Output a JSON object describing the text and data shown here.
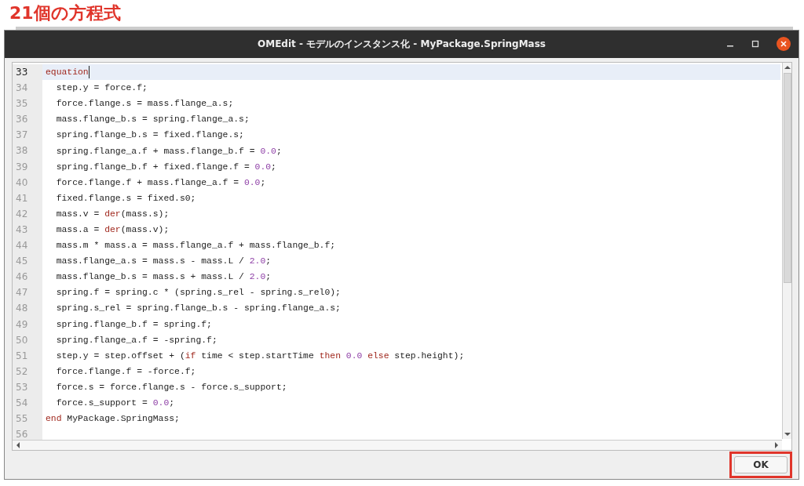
{
  "caption": "21個の方程式",
  "window": {
    "title": "OMEdit - モデルのインスタンス化 - MyPackage.SpringMass"
  },
  "editor": {
    "lines": [
      {
        "number": "33",
        "current": true,
        "tokens": [
          {
            "t": "equation",
            "kind": "keyword"
          }
        ]
      },
      {
        "number": "34",
        "current": false,
        "tokens": [
          {
            "t": "  step.y = force.f;",
            "kind": "plain"
          }
        ]
      },
      {
        "number": "35",
        "current": false,
        "tokens": [
          {
            "t": "  force.flange.s = mass.flange_a.s;",
            "kind": "plain"
          }
        ]
      },
      {
        "number": "36",
        "current": false,
        "tokens": [
          {
            "t": "  mass.flange_b.s = spring.flange_a.s;",
            "kind": "plain"
          }
        ]
      },
      {
        "number": "37",
        "current": false,
        "tokens": [
          {
            "t": "  spring.flange_b.s = fixed.flange.s;",
            "kind": "plain"
          }
        ]
      },
      {
        "number": "38",
        "current": false,
        "tokens": [
          {
            "t": "  spring.flange_a.f + mass.flange_b.f = ",
            "kind": "plain"
          },
          {
            "t": "0.0",
            "kind": "number"
          },
          {
            "t": ";",
            "kind": "plain"
          }
        ]
      },
      {
        "number": "39",
        "current": false,
        "tokens": [
          {
            "t": "  spring.flange_b.f + fixed.flange.f = ",
            "kind": "plain"
          },
          {
            "t": "0.0",
            "kind": "number"
          },
          {
            "t": ";",
            "kind": "plain"
          }
        ]
      },
      {
        "number": "40",
        "current": false,
        "tokens": [
          {
            "t": "  force.flange.f + mass.flange_a.f = ",
            "kind": "plain"
          },
          {
            "t": "0.0",
            "kind": "number"
          },
          {
            "t": ";",
            "kind": "plain"
          }
        ]
      },
      {
        "number": "41",
        "current": false,
        "tokens": [
          {
            "t": "  fixed.flange.s = fixed.s0;",
            "kind": "plain"
          }
        ]
      },
      {
        "number": "42",
        "current": false,
        "tokens": [
          {
            "t": "  mass.v = ",
            "kind": "plain"
          },
          {
            "t": "der",
            "kind": "keyword"
          },
          {
            "t": "(mass.s);",
            "kind": "plain"
          }
        ]
      },
      {
        "number": "43",
        "current": false,
        "tokens": [
          {
            "t": "  mass.a = ",
            "kind": "plain"
          },
          {
            "t": "der",
            "kind": "keyword"
          },
          {
            "t": "(mass.v);",
            "kind": "plain"
          }
        ]
      },
      {
        "number": "44",
        "current": false,
        "tokens": [
          {
            "t": "  mass.m * mass.a = mass.flange_a.f + mass.flange_b.f;",
            "kind": "plain"
          }
        ]
      },
      {
        "number": "45",
        "current": false,
        "tokens": [
          {
            "t": "  mass.flange_a.s = mass.s - mass.L / ",
            "kind": "plain"
          },
          {
            "t": "2.0",
            "kind": "number"
          },
          {
            "t": ";",
            "kind": "plain"
          }
        ]
      },
      {
        "number": "46",
        "current": false,
        "tokens": [
          {
            "t": "  mass.flange_b.s = mass.s + mass.L / ",
            "kind": "plain"
          },
          {
            "t": "2.0",
            "kind": "number"
          },
          {
            "t": ";",
            "kind": "plain"
          }
        ]
      },
      {
        "number": "47",
        "current": false,
        "tokens": [
          {
            "t": "  spring.f = spring.c * (spring.s_rel - spring.s_rel0);",
            "kind": "plain"
          }
        ]
      },
      {
        "number": "48",
        "current": false,
        "tokens": [
          {
            "t": "  spring.s_rel = spring.flange_b.s - spring.flange_a.s;",
            "kind": "plain"
          }
        ]
      },
      {
        "number": "49",
        "current": false,
        "tokens": [
          {
            "t": "  spring.flange_b.f = spring.f;",
            "kind": "plain"
          }
        ]
      },
      {
        "number": "50",
        "current": false,
        "tokens": [
          {
            "t": "  spring.flange_a.f = -spring.f;",
            "kind": "plain"
          }
        ]
      },
      {
        "number": "51",
        "current": false,
        "tokens": [
          {
            "t": "  step.y = step.offset + (",
            "kind": "plain"
          },
          {
            "t": "if",
            "kind": "keyword"
          },
          {
            "t": " time < step.startTime ",
            "kind": "plain"
          },
          {
            "t": "then ",
            "kind": "keyword"
          },
          {
            "t": "0.0",
            "kind": "number"
          },
          {
            "t": " else",
            "kind": "keyword"
          },
          {
            "t": " step.height);",
            "kind": "plain"
          }
        ]
      },
      {
        "number": "52",
        "current": false,
        "tokens": [
          {
            "t": "  force.flange.f = -force.f;",
            "kind": "plain"
          }
        ]
      },
      {
        "number": "53",
        "current": false,
        "tokens": [
          {
            "t": "  force.s = force.flange.s - force.s_support;",
            "kind": "plain"
          }
        ]
      },
      {
        "number": "54",
        "current": false,
        "tokens": [
          {
            "t": "  force.s_support = ",
            "kind": "plain"
          },
          {
            "t": "0.0",
            "kind": "number"
          },
          {
            "t": ";",
            "kind": "plain"
          }
        ]
      },
      {
        "number": "55",
        "current": false,
        "tokens": [
          {
            "t": "end",
            "kind": "keyword"
          },
          {
            "t": " MyPackage.SpringMass;",
            "kind": "plain"
          }
        ]
      },
      {
        "number": "56",
        "current": false
      }
    ]
  },
  "ok_button": {
    "label": "OK",
    "highlighted": true
  }
}
